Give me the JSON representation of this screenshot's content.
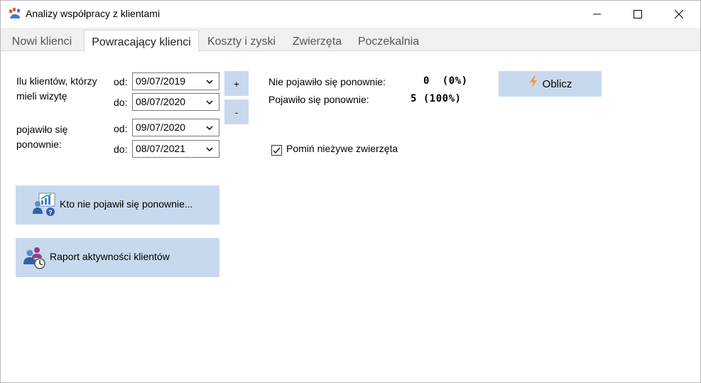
{
  "window": {
    "title": "Analizy współpracy z klientami",
    "icon": "paw-app-icon"
  },
  "tabs": [
    {
      "label": "Nowi klienci",
      "active": false
    },
    {
      "label": "Powracający klienci",
      "active": true
    },
    {
      "label": "Koszty i zyski",
      "active": false
    },
    {
      "label": "Zwierzęta",
      "active": false
    },
    {
      "label": "Poczekalnia",
      "active": false
    }
  ],
  "visits": {
    "label": "Ilu klientów, którzy mieli wizytę",
    "from_label": "od:",
    "to_label": "do:",
    "from_value": "09/07/2019",
    "to_value": "08/07/2020"
  },
  "returned": {
    "label": "pojawiło się ponownie:",
    "from_label": "od:",
    "to_label": "do:",
    "from_value": "09/07/2020",
    "to_value": "08/07/2021"
  },
  "buttons": {
    "plus": "+",
    "minus": "-",
    "calculate": "Oblicz",
    "who_not_returned": "Kto nie pojawił się ponownie...",
    "activity_report": "Raport aktywności klientów"
  },
  "stats": {
    "not_returned_label": "Nie pojawiło się ponownie:",
    "not_returned_value": "0  (0%)",
    "returned_label": "Pojawiło się ponownie:",
    "returned_value": "5 (100%)"
  },
  "options": {
    "skip_dead_animals_label": "Pomiń nieżywe zwierzęta",
    "skip_dead_animals_checked": true
  },
  "colors": {
    "button_bg": "#c8d9ee",
    "tabstrip_bg": "#f0f0f0",
    "bolt": "#f0a020"
  }
}
